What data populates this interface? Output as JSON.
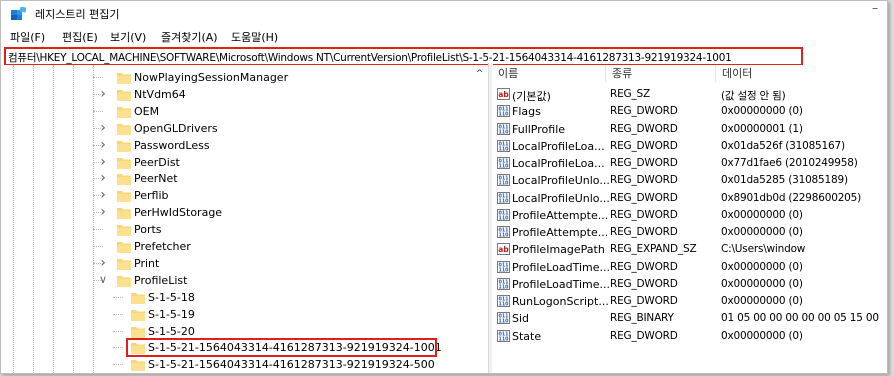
{
  "window": {
    "title": "레지스트리 편집기"
  },
  "menu": [
    "파일(F)",
    "편집(E)",
    "보기(V)",
    "즐겨찾기(A)",
    "도움말(H)"
  ],
  "address": "컴퓨터\\HKEY_LOCAL_MACHINE\\SOFTWARE\\Microsoft\\Windows NT\\CurrentVersion\\ProfileList\\S-1-5-21-1564043314-4161287313-921919324-1001",
  "tree": [
    {
      "label": "NowPlayingSessionManager",
      "expander": ""
    },
    {
      "label": "NtVdm64",
      "expander": ">"
    },
    {
      "label": "OEM",
      "expander": ""
    },
    {
      "label": "OpenGLDrivers",
      "expander": ">"
    },
    {
      "label": "PasswordLess",
      "expander": ">"
    },
    {
      "label": "PeerDist",
      "expander": ">"
    },
    {
      "label": "PeerNet",
      "expander": ">"
    },
    {
      "label": "Perflib",
      "expander": ">"
    },
    {
      "label": "PerHwIdStorage",
      "expander": ">"
    },
    {
      "label": "Ports",
      "expander": ""
    },
    {
      "label": "Prefetcher",
      "expander": ""
    },
    {
      "label": "Print",
      "expander": ">"
    },
    {
      "label": "ProfileList",
      "expander": "v"
    },
    {
      "label": "S-1-5-18",
      "expander": ""
    },
    {
      "label": "S-1-5-19",
      "expander": ""
    },
    {
      "label": "S-1-5-20",
      "expander": ""
    },
    {
      "label": "S-1-5-21-1564043314-4161287313-921919324-1001",
      "expander": "",
      "selected": true
    },
    {
      "label": "S-1-5-21-1564043314-4161287313-921919324-500",
      "expander": ""
    }
  ],
  "columns": {
    "name": "이름",
    "type": "종류",
    "data": "데이터"
  },
  "values": [
    {
      "icon": "string-value-icon",
      "name": "(기본값)",
      "type": "REG_SZ",
      "data": "(값 설정 안 됨)"
    },
    {
      "icon": "binary-value-icon",
      "name": "Flags",
      "type": "REG_DWORD",
      "data": "0x00000000 (0)"
    },
    {
      "icon": "binary-value-icon",
      "name": "FullProfile",
      "type": "REG_DWORD",
      "data": "0x00000001 (1)"
    },
    {
      "icon": "binary-value-icon",
      "name": "LocalProfileLoa...",
      "type": "REG_DWORD",
      "data": "0x01da526f (31085167)"
    },
    {
      "icon": "binary-value-icon",
      "name": "LocalProfileLoa...",
      "type": "REG_DWORD",
      "data": "0x77d1fae6 (2010249958)"
    },
    {
      "icon": "binary-value-icon",
      "name": "LocalProfileUnlo...",
      "type": "REG_DWORD",
      "data": "0x01da5285 (31085189)"
    },
    {
      "icon": "binary-value-icon",
      "name": "LocalProfileUnlo...",
      "type": "REG_DWORD",
      "data": "0x8901db0d (2298600205)"
    },
    {
      "icon": "binary-value-icon",
      "name": "ProfileAttempte...",
      "type": "REG_DWORD",
      "data": "0x00000000 (0)"
    },
    {
      "icon": "binary-value-icon",
      "name": "ProfileAttempte...",
      "type": "REG_DWORD",
      "data": "0x00000000 (0)"
    },
    {
      "icon": "string-value-icon",
      "name": "ProfileImagePath",
      "type": "REG_EXPAND_SZ",
      "data": "C:\\Users\\window"
    },
    {
      "icon": "binary-value-icon",
      "name": "ProfileLoadTime...",
      "type": "REG_DWORD",
      "data": "0x00000000 (0)"
    },
    {
      "icon": "binary-value-icon",
      "name": "ProfileLoadTime...",
      "type": "REG_DWORD",
      "data": "0x00000000 (0)"
    },
    {
      "icon": "binary-value-icon",
      "name": "RunLogonScript...",
      "type": "REG_DWORD",
      "data": "0x00000000 (0)"
    },
    {
      "icon": "binary-value-icon",
      "name": "Sid",
      "type": "REG_BINARY",
      "data": "01 05 00 00 00 00 00 05 15 00"
    },
    {
      "icon": "binary-value-icon",
      "name": "State",
      "type": "REG_DWORD",
      "data": "0x00000000 (0)"
    }
  ],
  "colors": {
    "highlight": "#e0201c",
    "folder": "#f7d675"
  }
}
